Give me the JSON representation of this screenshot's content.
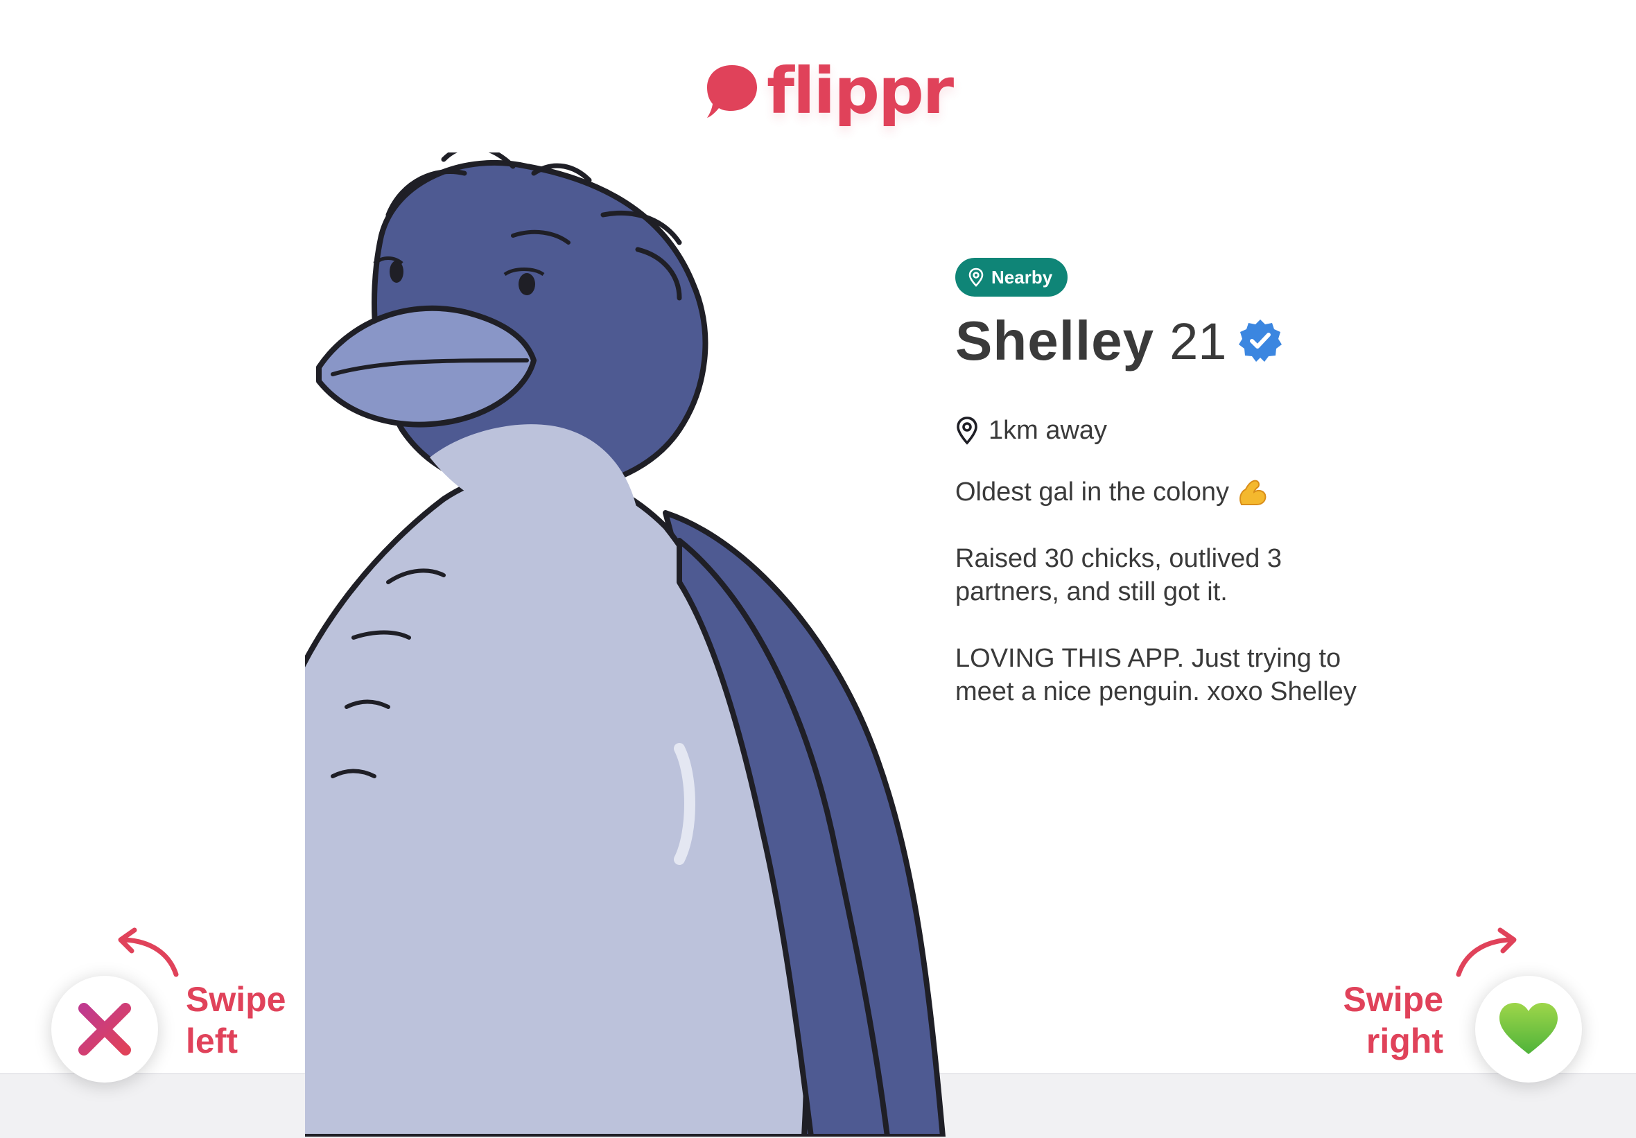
{
  "app": {
    "name": "flippr",
    "brand_color": "#e0425a"
  },
  "profile": {
    "badge": "Nearby",
    "badge_icon": "location-pin-icon",
    "badge_color": "#0f8577",
    "name": "Shelley",
    "age": "21",
    "verified_icon": "verified-badge-icon",
    "distance": "1km away",
    "bio": [
      "Oldest gal in the colony",
      "Raised 30 chicks, outlived 3 partners, and still got it.",
      "LOVING THIS APP. Just trying to meet a nice penguin. xoxo Shelley"
    ],
    "bio_emoji": "flexed-biceps-icon"
  },
  "actions": {
    "left": {
      "label_line1": "Swipe",
      "label_line2": "left",
      "icon": "cross-icon"
    },
    "right": {
      "label_line1": "Swipe",
      "label_line2": "right",
      "icon": "green-heart-icon"
    }
  }
}
